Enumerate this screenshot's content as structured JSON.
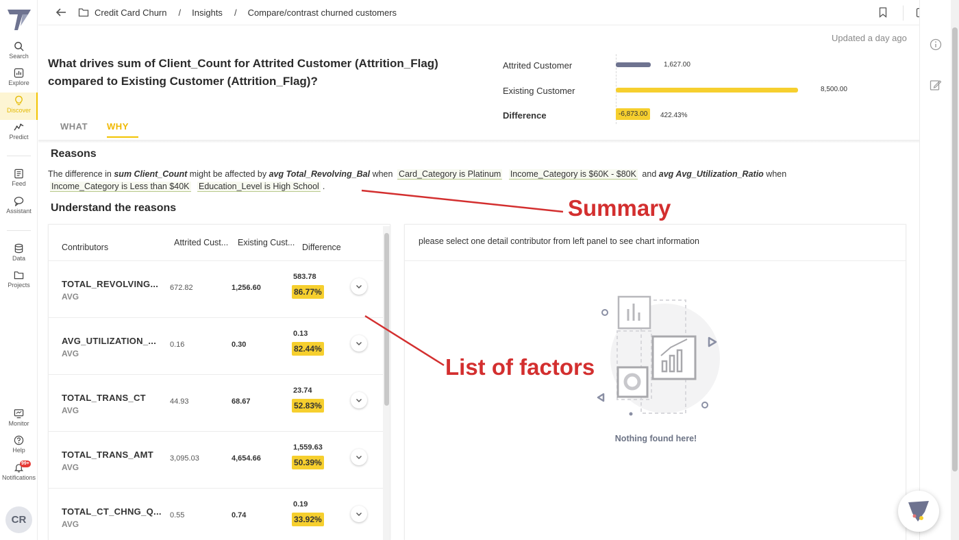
{
  "nav": {
    "items": [
      {
        "label": "Search",
        "icon": "search-icon"
      },
      {
        "label": "Explore",
        "icon": "chart-icon"
      },
      {
        "label": "Discover",
        "icon": "bulb-icon"
      },
      {
        "label": "Predict",
        "icon": "trend-icon"
      },
      {
        "label": "Feed",
        "icon": "feed-icon"
      },
      {
        "label": "Assistant",
        "icon": "chat-icon"
      },
      {
        "label": "Data",
        "icon": "database-icon"
      },
      {
        "label": "Projects",
        "icon": "folder-icon"
      },
      {
        "label": "Monitor",
        "icon": "monitor-icon"
      },
      {
        "label": "Help",
        "icon": "help-icon"
      },
      {
        "label": "Notifications",
        "icon": "bell-icon"
      }
    ],
    "notif_count": "99+",
    "avatar": "CR"
  },
  "breadcrumb": {
    "items": [
      "Credit Card Churn",
      "Insights",
      "Compare/contrast churned customers"
    ],
    "separator": "/"
  },
  "updated": "Updated  a day ago",
  "question": "What drives sum of Client_Count for Attrited Customer (Attrition_Flag) compared to Existing Customer (Attrition_Flag)?",
  "tabs": [
    "WHAT",
    "WHY"
  ],
  "comparison": {
    "rows": [
      {
        "label": "Attrited Customer",
        "value": 1627.0,
        "display": "1,627.00",
        "color": "#6e7390"
      },
      {
        "label": "Existing Customer",
        "value": 8500.0,
        "display": "8,500.00",
        "color": "#f6cf2e"
      }
    ],
    "difference_label": "Difference",
    "difference_value": "-6,873.00",
    "difference_pct": "422.43%"
  },
  "reasons": {
    "title": "Reasons",
    "summary": {
      "t1": "The difference in ",
      "metric": "sum Client_Count",
      "t2": " might be affected by ",
      "f1": "avg Total_Revolving_Bal",
      "t3": " when ",
      "c1": "Card_Category is Platinum",
      "c2": "Income_Category is $60K - $80K",
      "t4": " and ",
      "f2": "avg Avg_Utilization_Ratio",
      "t5": " when",
      "c3": "Income_Category is Less than $40K",
      "c4": "Education_Level is High School",
      "t6": "."
    }
  },
  "understand_title": "Understand the reasons",
  "annotations": {
    "summary": "Summary",
    "factors": "List of factors"
  },
  "contributors": {
    "headers": {
      "name": "Contributors",
      "attrited": "Attrited Cust...",
      "existing": "Existing Cust...",
      "difference": "Difference"
    },
    "rows": [
      {
        "name": "TOTAL_REVOLVING...",
        "agg": "AVG",
        "attrited": "672.82",
        "existing": "1,256.60",
        "diff": "583.78",
        "pct": "86.77%"
      },
      {
        "name": "AVG_UTILIZATION_...",
        "agg": "AVG",
        "attrited": "0.16",
        "existing": "0.30",
        "diff": "0.13",
        "pct": "82.44%"
      },
      {
        "name": "TOTAL_TRANS_CT",
        "agg": "AVG",
        "attrited": "44.93",
        "existing": "68.67",
        "diff": "23.74",
        "pct": "52.83%"
      },
      {
        "name": "TOTAL_TRANS_AMT",
        "agg": "AVG",
        "attrited": "3,095.03",
        "existing": "4,654.66",
        "diff": "1,559.63",
        "pct": "50.39%"
      },
      {
        "name": "TOTAL_CT_CHNG_Q...",
        "agg": "AVG",
        "attrited": "0.55",
        "existing": "0.74",
        "diff": "0.19",
        "pct": "33.92%"
      }
    ]
  },
  "chart_panel": {
    "hint": "please select one detail contributor from left panel to see chart information",
    "empty": "Nothing found here!"
  },
  "colors": {
    "accent": "#f2c300",
    "annotation": "#d32f2f",
    "slate": "#6e7390"
  }
}
